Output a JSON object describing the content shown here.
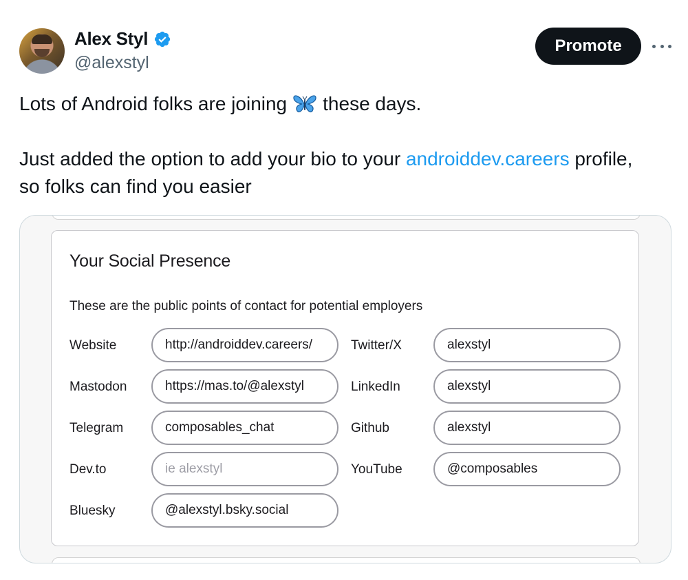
{
  "author": {
    "name": "Alex Styl",
    "handle": "@alexstyl",
    "verified": true,
    "verified_color": "#1d9bf0"
  },
  "actions": {
    "promote_label": "Promote",
    "more_icon": "more-horizontal-icon"
  },
  "tweet": {
    "line1_before": "Lots of Android folks are joining",
    "line1_emoji": "butterfly-icon",
    "line1_after": "these days.",
    "line2_before": "Just added the option to add your bio to your ",
    "line2_link": "androiddev.careers",
    "line2_after": " profile,",
    "line3": "so folks can find you easier",
    "link_color": "#1d9bf0"
  },
  "media_card": {
    "title": "Your Social Presence",
    "subtitle": "These are the public points of contact for potential employers",
    "fields": {
      "website": {
        "label": "Website",
        "value": "http://androiddev.careers/"
      },
      "twitter": {
        "label": "Twitter/X",
        "value": "alexstyl"
      },
      "mastodon": {
        "label": "Mastodon",
        "value": "https://mas.to/@alexstyl"
      },
      "linkedin": {
        "label": "LinkedIn",
        "value": "alexstyl"
      },
      "telegram": {
        "label": "Telegram",
        "value": "composables_chat"
      },
      "github": {
        "label": "Github",
        "value": "alexstyl"
      },
      "devto": {
        "label": "Dev.to",
        "value": "",
        "placeholder": "ie alexstyl"
      },
      "youtube": {
        "label": "YouTube",
        "value": "@composables"
      },
      "bluesky": {
        "label": "Bluesky",
        "value": "@alexstyl.bsky.social"
      }
    }
  }
}
